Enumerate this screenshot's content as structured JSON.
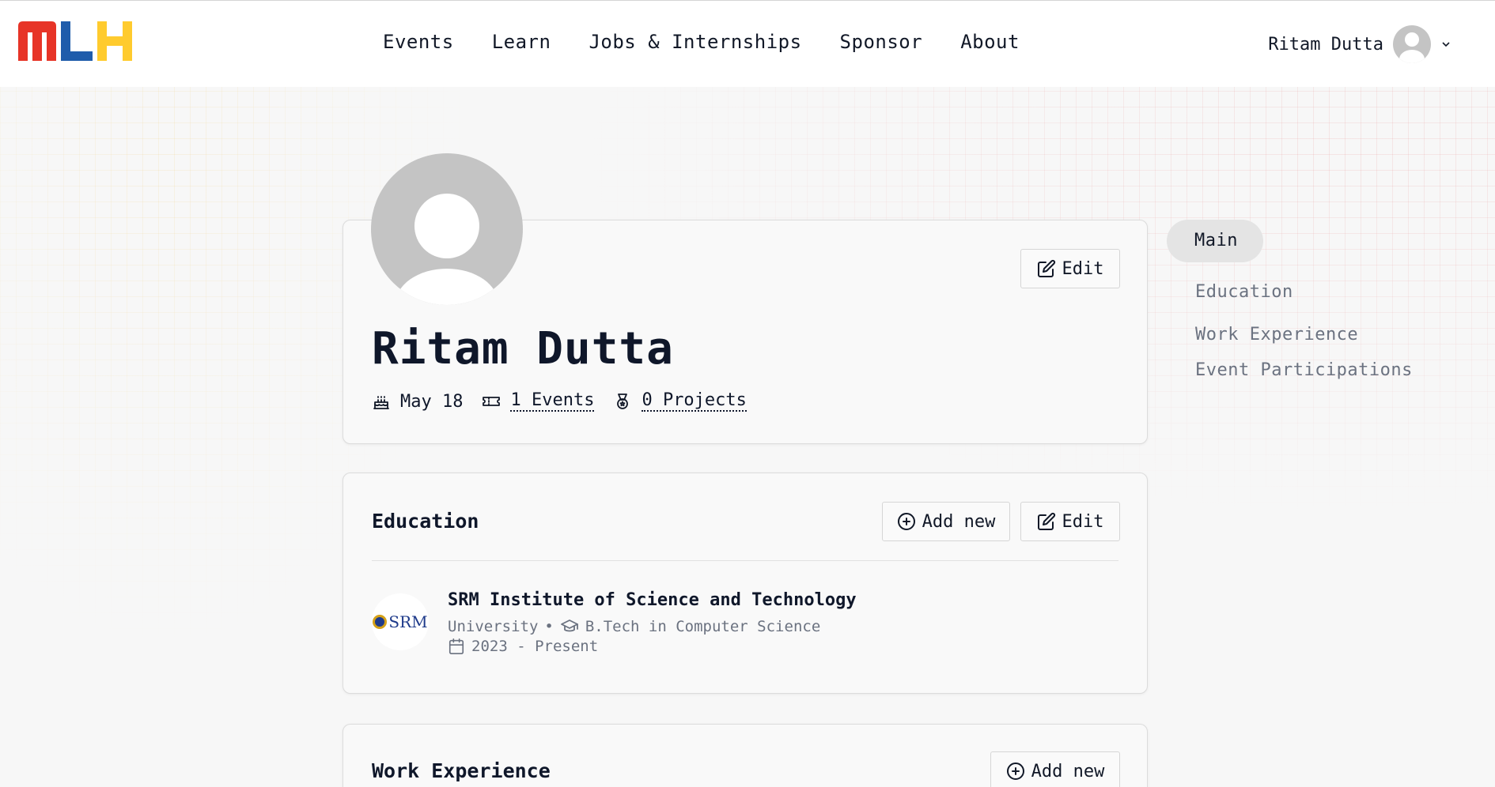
{
  "header": {
    "logo_letters": [
      "M",
      "L",
      "H"
    ],
    "logo_colors": [
      "#E73427",
      "#1F5CAB",
      "#FFCB2E"
    ],
    "nav": [
      {
        "label": "Events"
      },
      {
        "label": "Learn"
      },
      {
        "label": "Jobs & Internships"
      },
      {
        "label": "Sponsor"
      },
      {
        "label": "About"
      }
    ],
    "user_name": "Ritam Dutta",
    "chevron_icon": "chevron-down-icon"
  },
  "profile": {
    "name": "Ritam Dutta",
    "edit_label": "Edit",
    "birthday": "May 18",
    "events_link": "1 Events",
    "projects_link": "0 Projects"
  },
  "education": {
    "title": "Education",
    "add_label": "Add new",
    "edit_label": "Edit",
    "items": [
      {
        "logo_text": "SRM",
        "school": "SRM Institute of Science and Technology",
        "type": "University",
        "separator": "•",
        "degree": "B.Tech in Computer Science",
        "dates": "2023 - Present"
      }
    ]
  },
  "work": {
    "title": "Work Experience",
    "add_label": "Add new"
  },
  "sidenav": {
    "items": [
      {
        "label": "Main",
        "active": true
      },
      {
        "label": "Education"
      },
      {
        "label": "Work Experience"
      },
      {
        "label": "Event Participations"
      }
    ]
  },
  "colors": {
    "text": "#0f172a",
    "muted": "#6b7280",
    "card_bg": "#f9f9f9",
    "active_pill": "#e4e4e4"
  }
}
